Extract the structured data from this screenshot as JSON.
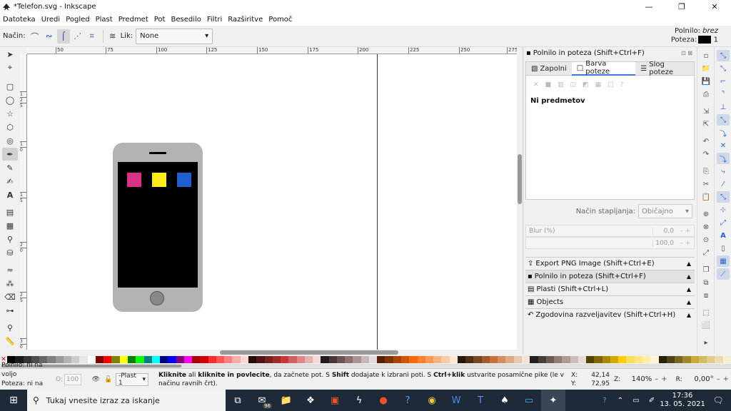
{
  "window": {
    "title": "*Telefon.svg - Inkscape",
    "minimize": "—",
    "maximize": "❐",
    "close": "✕"
  },
  "menu": [
    "Datoteka",
    "Uredi",
    "Pogled",
    "Plast",
    "Predmet",
    "Pot",
    "Besedilo",
    "Filtri",
    "Razširitve",
    "Pomoč"
  ],
  "tool_controls": {
    "mode_label": "Način:",
    "shape_label": "Lik:",
    "shape_value": "None"
  },
  "style_indicator": {
    "fill_label": "Polnilo:",
    "fill_value": "brez",
    "stroke_label": "Poteza:",
    "stroke_width": "1",
    "stroke_color": "#000000"
  },
  "ruler": {
    "h_ticks": [
      "50",
      "75",
      "100",
      "125",
      "150",
      "175",
      "200",
      "225",
      "250",
      "275"
    ],
    "v_ticks": [
      "1",
      "2",
      "5",
      "1",
      "0",
      "1",
      "5",
      "2",
      "0",
      "2",
      "5",
      "3",
      "0"
    ]
  },
  "drawing": {
    "phone_body": "#b3b3b3",
    "screen": "#000000",
    "squares": [
      "#d63384",
      "#ffeb1a",
      "#1f5fd0"
    ]
  },
  "dock": {
    "header": "Polnilo in poteza  (Shift+Ctrl+F)",
    "tabs": [
      "Zapolni",
      "Barva poteze",
      "Slog poteze"
    ],
    "no_selection": "Ni predmetov",
    "blend_label": "Način stapljanja:",
    "blend_value": "Običajno",
    "blur_label": "Blur (%)",
    "blur_value": "0,0",
    "opacity_value": "100,0",
    "sections": [
      "Export PNG Image (Shift+Ctrl+E)",
      "Polnilo in poteza  (Shift+Ctrl+F)",
      "Plasti  (Shift+Ctrl+L)",
      "Objects",
      "Zgodovina razveljavitev  (Shift+Ctrl+H)"
    ]
  },
  "palette_colors": [
    "#000000",
    "#1a1a1a",
    "#333333",
    "#4d4d4d",
    "#666666",
    "#808080",
    "#999999",
    "#b3b3b3",
    "#cccccc",
    "#e6e6e6",
    "#ffffff",
    "#800000",
    "#ff0000",
    "#808000",
    "#ffff00",
    "#008000",
    "#00ff00",
    "#008080",
    "#00ffff",
    "#000080",
    "#0000ff",
    "#800080",
    "#ff00ff",
    "#aa0000",
    "#d40000",
    "#ff2a2a",
    "#ff5555",
    "#ff8080",
    "#ffaaaa",
    "#ffd5d5",
    "#280b0b",
    "#501616",
    "#782121",
    "#a02c2c",
    "#c83737",
    "#d35f5f",
    "#de8787",
    "#e9afaf",
    "#f4d7d7",
    "#241c1c",
    "#483737",
    "#6c5353",
    "#916f6f",
    "#ac9393",
    "#c8b7b7",
    "#e3dbdb",
    "#552200",
    "#803300",
    "#aa4400",
    "#d45500",
    "#ff6600",
    "#ff7f2a",
    "#ff9955",
    "#ffb380",
    "#ffccaa",
    "#ffe6d5",
    "#28170b",
    "#502d16",
    "#784421",
    "#a05a2c",
    "#c87137",
    "#d38d5f",
    "#deaa87",
    "#e9c6af",
    "#f4e3d7",
    "#241f1c",
    "#483e37",
    "#6c5d53",
    "#917c6f",
    "#ac9d93",
    "#c8beb7",
    "#e3dedb",
    "#554400",
    "#806600",
    "#aa8800",
    "#d4aa00",
    "#ffcc00",
    "#ffdd55",
    "#ffe680",
    "#ffeeaa",
    "#fff6d5",
    "#28220b",
    "#504416",
    "#786721",
    "#a0892c",
    "#c8ab37",
    "#d3bc5f",
    "#decd87",
    "#e9ddaf",
    "#f4eed7"
  ],
  "status": {
    "fill_label": "Polnilo:",
    "fill_value": "ni na voljo",
    "stroke_label": "Poteza:",
    "stroke_value": "ni na voljo",
    "opacity_label": "O:",
    "opacity_value": "100",
    "layer": "-Plast 1",
    "message_bold1": "Kliknite",
    "message_t1": " ali ",
    "message_bold2": "kliknite in povlecite",
    "message_t2": ", da začnete pot. S ",
    "message_bold3": "Shift",
    "message_t3": " dodajate k izbrani poti. S ",
    "message_bold4": "Ctrl+klik",
    "message_t4": " ustvarite posamične pike (le v načinu ravnih črt).",
    "x_label": "X:",
    "x_value": "42,14",
    "y_label": "Y:",
    "y_value": "72,95",
    "zoom_label": "Z:",
    "zoom_value": "140%",
    "rotate_label": "R:",
    "rotate_value": "0,00°"
  },
  "taskbar": {
    "search_placeholder": "Tukaj vnesite izraz za iskanje",
    "mail_badge": "96",
    "time": "17:36",
    "date": "13. 05. 2021"
  }
}
